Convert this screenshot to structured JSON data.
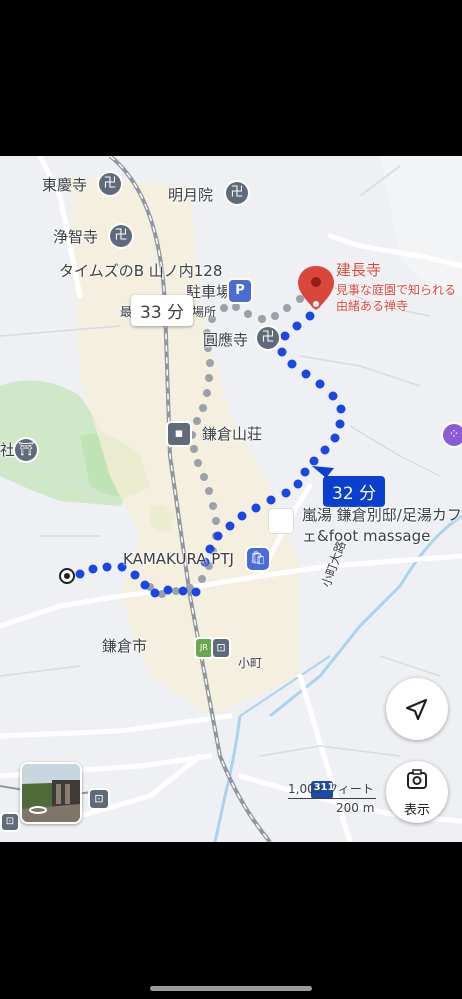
{
  "map": {
    "labels": {
      "tokeiji": "東慶寺",
      "meigetsuin": "明月院",
      "jochiji": "浄智寺",
      "times_parking_line1": "タイムズのB 山ノ内128",
      "times_parking_line2": "駐車場",
      "sai": "最",
      "sho": "場所",
      "ennoji": "圓應寺",
      "kamakura_sanso": "鎌倉山荘",
      "kamakura_ptj": "KAMAKURA PTJ",
      "kamakura_city": "鎌倉市",
      "komachi": "小町",
      "komachi_oji": "小町大路",
      "jinja": "社",
      "ranyu_line1": "嵐湯 鎌倉別邸/足湯カフ",
      "ranyu_line2": "ェ&foot massage",
      "jr": "JR"
    },
    "destination": {
      "name": "建長寺",
      "desc_line1": "見事な庭園で知られる",
      "desc_line2": "由緒ある禅寺"
    },
    "routes": {
      "alt_time": "33 分",
      "main_time": "32 分"
    },
    "scale": {
      "feet": "1,000 フィート",
      "meters": "200 m"
    },
    "route_badge": "311",
    "buttons": {
      "display_label": "表示"
    },
    "colors": {
      "route_blue": "#1a46e8",
      "alt_route_gray": "#9aa1a8",
      "destination_red": "#d9473b"
    },
    "icons": [
      "temple-icon",
      "parking-icon",
      "hotel-icon",
      "shopping-icon",
      "shrine-icon",
      "train-icon",
      "navigation-icon",
      "lens-camera-icon"
    ]
  }
}
